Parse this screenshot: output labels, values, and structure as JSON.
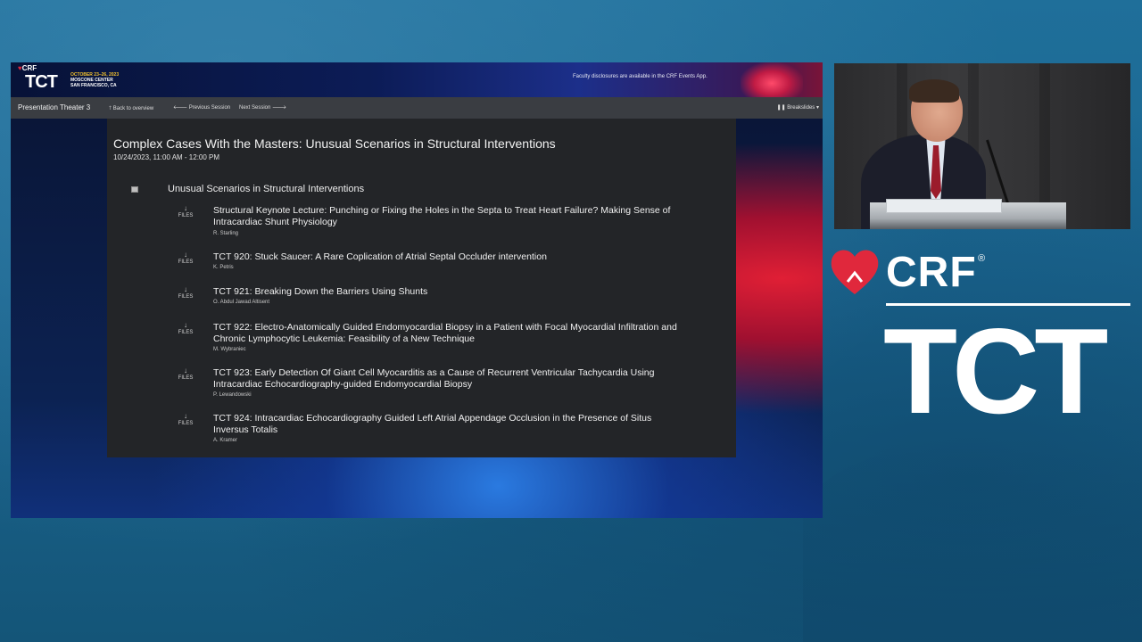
{
  "banner": {
    "crf": "CRF",
    "tct": "TCT",
    "date": "OCTOBER 23–26, 2023",
    "venue_line1": "MOSCONE CENTER",
    "venue_line2": "SAN FRANCISCO, CA",
    "disclosure": "Faculty disclosures are available in the CRF Events App."
  },
  "nav": {
    "room": "Presentation Theater 3",
    "back": "Back to overview",
    "previous": "Previous Session",
    "next": "Next Session",
    "breakslides": "Breakslides"
  },
  "session": {
    "title": "Complex Cases With the Masters: Unusual Scenarios in Structural Interventions",
    "time": "10/24/2023, 11:00 AM - 12:00 PM",
    "group_title": "Unusual Scenarios in Structural Interventions",
    "files_label": "FILES",
    "talks": [
      {
        "title": "Structural Keynote Lecture: Punching or Fixing the Holes in the Septa to Treat Heart Failure? Making Sense of Intracardiac Shunt Physiology",
        "speaker": "R. Starling"
      },
      {
        "title": "TCT 920: Stuck Saucer: A Rare Coplication of Atrial Septal Occluder intervention",
        "speaker": "K. Petris"
      },
      {
        "title": "TCT 921: Breaking Down the Barriers Using Shunts",
        "speaker": "O. Abdul Jawad Altisent"
      },
      {
        "title": "TCT 922: Electro-Anatomically Guided Endomyocardial Biopsy in a Patient with Focal Myocardial Infiltration and Chronic Lymphocytic Leukemia: Feasibility of a New Technique",
        "speaker": "M. Wybraniec"
      },
      {
        "title": "TCT 923: Early Detection Of Giant Cell Myocarditis as a Cause of Recurrent Ventricular Tachycardia Using Intracardiac Echocardiography-guided Endomyocardial Biopsy",
        "speaker": "P. Lewandowski"
      },
      {
        "title": "TCT 924: Intracardiac Echocardiography Guided Left Atrial Appendage Occlusion in the Presence of Situs Inversus Totalis",
        "speaker": "A. Kramer"
      }
    ]
  },
  "branding": {
    "crf": "CRF",
    "registered": "®",
    "tct": "TCT"
  },
  "colors": {
    "background": "#1b6690",
    "navbar": "#3a3d42",
    "card": "#232528",
    "heart_red": "#e0283c",
    "date_yellow": "#f2c12e"
  },
  "icons": {
    "download": "arrow-down-icon",
    "arrow_up": "arrow-up-icon",
    "arrow_left": "arrow-left-icon",
    "arrow_right": "arrow-right-icon",
    "collapse": "collapse-square-icon"
  }
}
